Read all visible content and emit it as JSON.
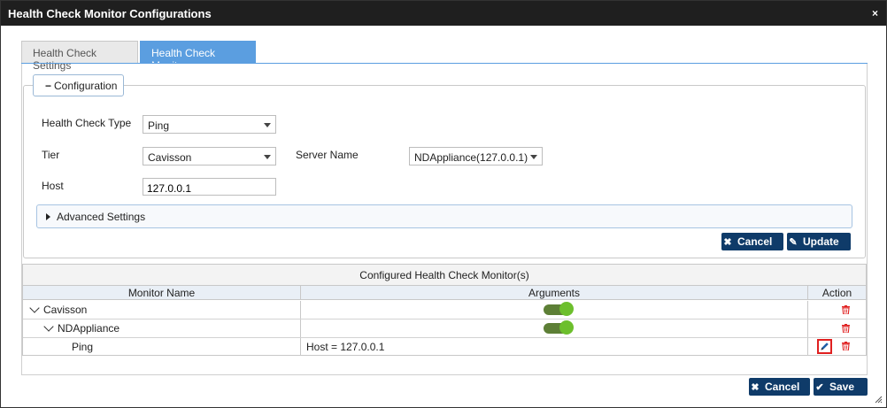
{
  "window": {
    "title": "Health Check Monitor Configurations",
    "close_glyph": "×"
  },
  "tabs": [
    {
      "label": "Health Check Settings",
      "active": false
    },
    {
      "label": "Health Check Monitor",
      "active": true
    }
  ],
  "config": {
    "legend": "Configuration",
    "health_check_type": {
      "label": "Health Check Type",
      "value": "Ping"
    },
    "tier": {
      "label": "Tier",
      "value": "Cavisson"
    },
    "server_name": {
      "label": "Server Name",
      "value": "NDAppliance(127.0.0.1)"
    },
    "host": {
      "label": "Host",
      "value": "127.0.0.1"
    },
    "advanced_label": "Advanced Settings",
    "cancel_label": "Cancel",
    "update_label": "Update"
  },
  "table": {
    "title": "Configured Health Check Monitor(s)",
    "columns": [
      "Monitor Name",
      "Arguments",
      "Action"
    ],
    "rows": [
      {
        "name": "Cavisson",
        "arguments": "",
        "toggle": true,
        "level": 0
      },
      {
        "name": "NDAppliance",
        "arguments": "",
        "toggle": true,
        "level": 1
      },
      {
        "name": "Ping",
        "arguments": "Host = 127.0.0.1",
        "toggle": false,
        "level": 2
      }
    ]
  },
  "footer": {
    "cancel_label": "Cancel",
    "save_label": "Save"
  },
  "colors": {
    "titlebar": "#1f1f1f",
    "active_tab": "#5b9ee0",
    "button": "#0f3b69",
    "toggle_on": "#6dbf2d",
    "delete": "#e02020"
  }
}
